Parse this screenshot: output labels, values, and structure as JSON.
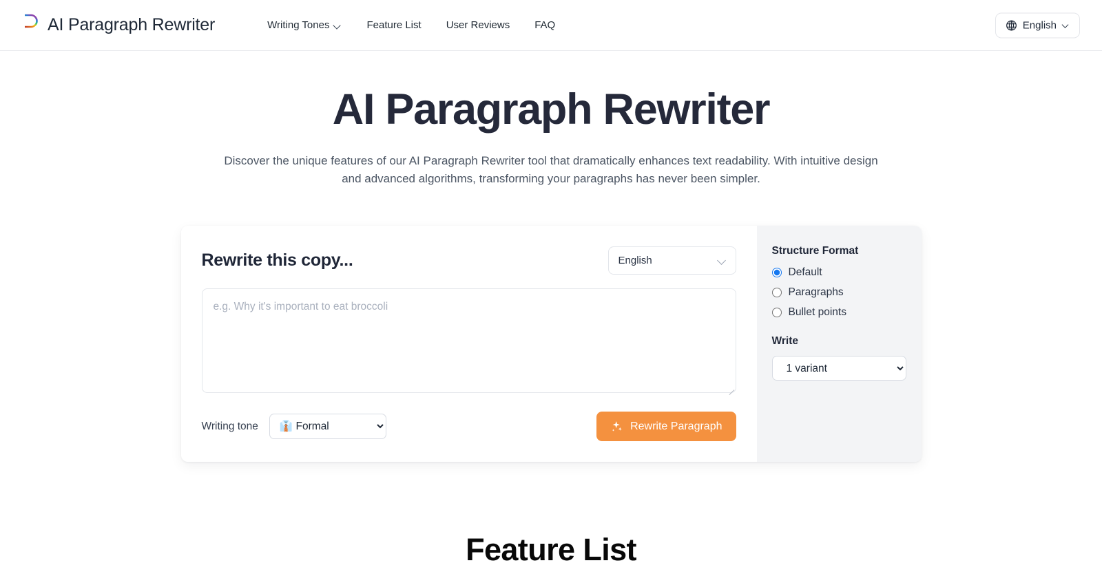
{
  "header": {
    "brand_name": "AI Paragraph Rewriter",
    "logo_icon": "rainbow-p-logo",
    "nav": [
      {
        "label": "Writing Tones",
        "has_chevron": true
      },
      {
        "label": "Feature List",
        "has_chevron": false
      },
      {
        "label": "User Reviews",
        "has_chevron": false
      },
      {
        "label": "FAQ",
        "has_chevron": false
      }
    ],
    "language_button": {
      "label": "English",
      "icon": "globe-icon",
      "chevron": "chevron-down-icon"
    }
  },
  "hero": {
    "title": "AI Paragraph Rewriter",
    "subtitle": "Discover the unique features of our AI Paragraph Rewriter tool that dramatically enhances text readability. With intuitive design and advanced algorithms, transforming your paragraphs has never been simpler."
  },
  "tool": {
    "title": "Rewrite this copy...",
    "language_select": {
      "value": "English",
      "options": [
        "English"
      ]
    },
    "textarea": {
      "value": "",
      "placeholder": "e.g. Why it's important to eat broccoli"
    },
    "tone": {
      "label": "Writing tone",
      "value": "👔 Formal",
      "options": [
        "👔 Formal"
      ]
    },
    "rewrite_button": {
      "label": "Rewrite Paragraph",
      "icon": "sparkles-icon",
      "color": "#f4913f"
    },
    "sidebar": {
      "structure_format_label": "Structure Format",
      "structure_options": [
        {
          "label": "Default",
          "selected": true
        },
        {
          "label": "Paragraphs",
          "selected": false
        },
        {
          "label": "Bullet points",
          "selected": false
        }
      ],
      "write_label": "Write",
      "variant_select": {
        "value": "1 variant",
        "options": [
          "1 variant"
        ]
      },
      "accent_color": "#1477f0",
      "background_color": "#f3f4f6"
    }
  },
  "feature_section": {
    "title": "Feature List"
  }
}
